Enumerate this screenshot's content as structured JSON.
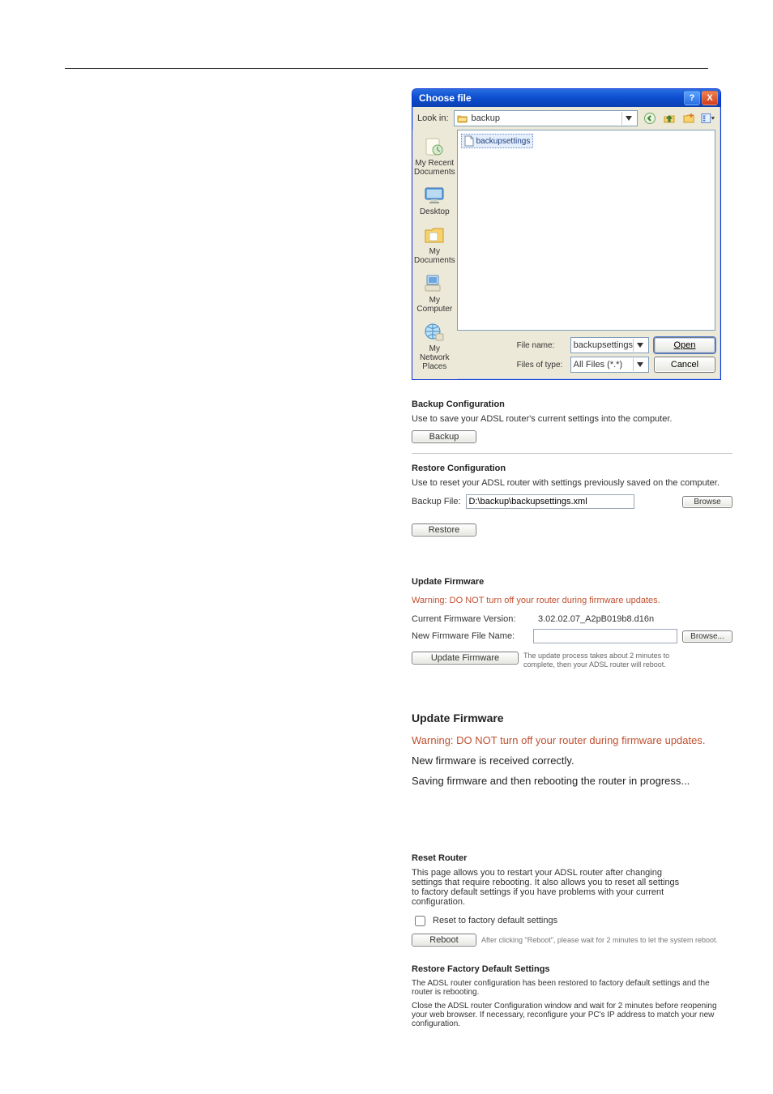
{
  "choose_file": {
    "title": "Choose file",
    "lookin_label": "Look in:",
    "lookin_value": "backup",
    "selected_file": "backupsettings",
    "places": [
      {
        "label": "My Recent Documents"
      },
      {
        "label": "Desktop"
      },
      {
        "label": "My Documents"
      },
      {
        "label": "My Computer"
      },
      {
        "label": "My Network Places"
      }
    ],
    "filename_label": "File name:",
    "filename_value": "backupsettings",
    "filetype_label": "Files of type:",
    "filetype_value": "All Files (*.*)",
    "open_label": "Open",
    "cancel_label": "Cancel"
  },
  "backup": {
    "title": "Backup Configuration",
    "desc": "Use to save your ADSL router's current settings into the computer.",
    "button": "Backup"
  },
  "restore": {
    "title": "Restore Configuration",
    "desc": "Use to reset your ADSL router with settings previously saved on the computer.",
    "file_label": "Backup File:",
    "file_value": "D:\\backup\\backupsettings.xml",
    "browse": "Browse",
    "button": "Restore"
  },
  "update_compact": {
    "title": "Update Firmware",
    "warn": "Warning: DO NOT turn off your router during firmware updates.",
    "current_label": "Current Firmware Version:",
    "current_value": "3.02.02.07_A2pB019b8.d16n",
    "new_label": "New Firmware File Name:",
    "new_value": "",
    "browse": "Browse...",
    "button": "Update Firmware",
    "hint": "The update process takes about 2 minutes to complete, then your ADSL router will reboot."
  },
  "update_large": {
    "title": "Update Firmware",
    "warn": "Warning: DO NOT turn off your router during firmware updates.",
    "line1": "New firmware is received correctly.",
    "line2": "Saving firmware and then rebooting the router in progress..."
  },
  "reset": {
    "title": "Reset Router",
    "desc": "This page allows you to restart your ADSL router after changing settings that require rebooting. It also allows you to reset all settings to factory default settings if you have problems with your current configuration.",
    "checkbox": "Reset to factory default settings",
    "button": "Reboot",
    "hint": "After clicking \"Reboot\", please wait for 2 minutes to let the system reboot."
  },
  "factory": {
    "title": "Restore Factory Default Settings",
    "line1": "The ADSL router configuration has been restored to factory default settings and the router is rebooting.",
    "line2": "Close the ADSL router Configuration window and wait for 2 minutes before reopening your web browser. If necessary, reconfigure your PC's IP address to match your new configuration."
  },
  "icons": {
    "help": "?",
    "close": "X"
  }
}
